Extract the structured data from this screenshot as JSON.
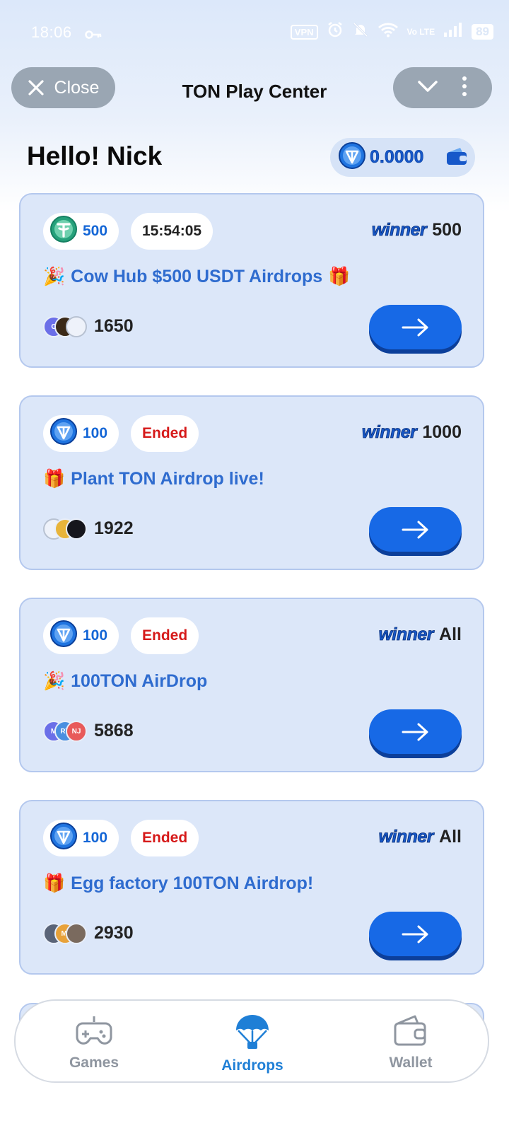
{
  "status_bar": {
    "time": "18:06",
    "vpn": "VPN",
    "lte": "Vo LTE",
    "battery": "89"
  },
  "header": {
    "close_label": "Close",
    "title": "TON Play Center"
  },
  "greeting": "Hello! Nick",
  "balance": "0.0000",
  "cards": [
    {
      "prize_amount": "500",
      "prize_icon": "tether-icon",
      "status": "15:54:05",
      "winner_label": "winner",
      "winner_value": "500",
      "emoji": "🎉",
      "title": "Cow Hub $500 USDT Airdrops",
      "title_suffix": "🎁",
      "participants": "1650"
    },
    {
      "prize_amount": "100",
      "prize_icon": "ton-icon",
      "status": "Ended",
      "winner_label": "winner",
      "winner_value": "1000",
      "emoji": "🎁",
      "title": "Plant TON Airdrop live!",
      "title_suffix": "",
      "participants": "1922"
    },
    {
      "prize_amount": "100",
      "prize_icon": "ton-icon",
      "status": "Ended",
      "winner_label": "winner",
      "winner_value": "All",
      "emoji": "🎉",
      "title": "100TON AirDrop",
      "title_suffix": "",
      "participants": "5868",
      "avatar_letters": [
        "M",
        "RT",
        "NJ"
      ]
    },
    {
      "prize_amount": "100",
      "prize_icon": "ton-icon",
      "status": "Ended",
      "winner_label": "winner",
      "winner_value": "All",
      "emoji": "🎁",
      "title": "Egg factory 100TON Airdrop!",
      "title_suffix": "",
      "participants": "2930",
      "avatar_letters": [
        "",
        "MI",
        ""
      ]
    }
  ],
  "nav": {
    "games": "Games",
    "airdrops": "Airdrops",
    "wallet": "Wallet",
    "active": "airdrops"
  },
  "colors": {
    "accent": "#1769e6",
    "ended": "#d61a1a",
    "card_bg": "#dce7f9",
    "active_nav": "#1f7fd6"
  }
}
